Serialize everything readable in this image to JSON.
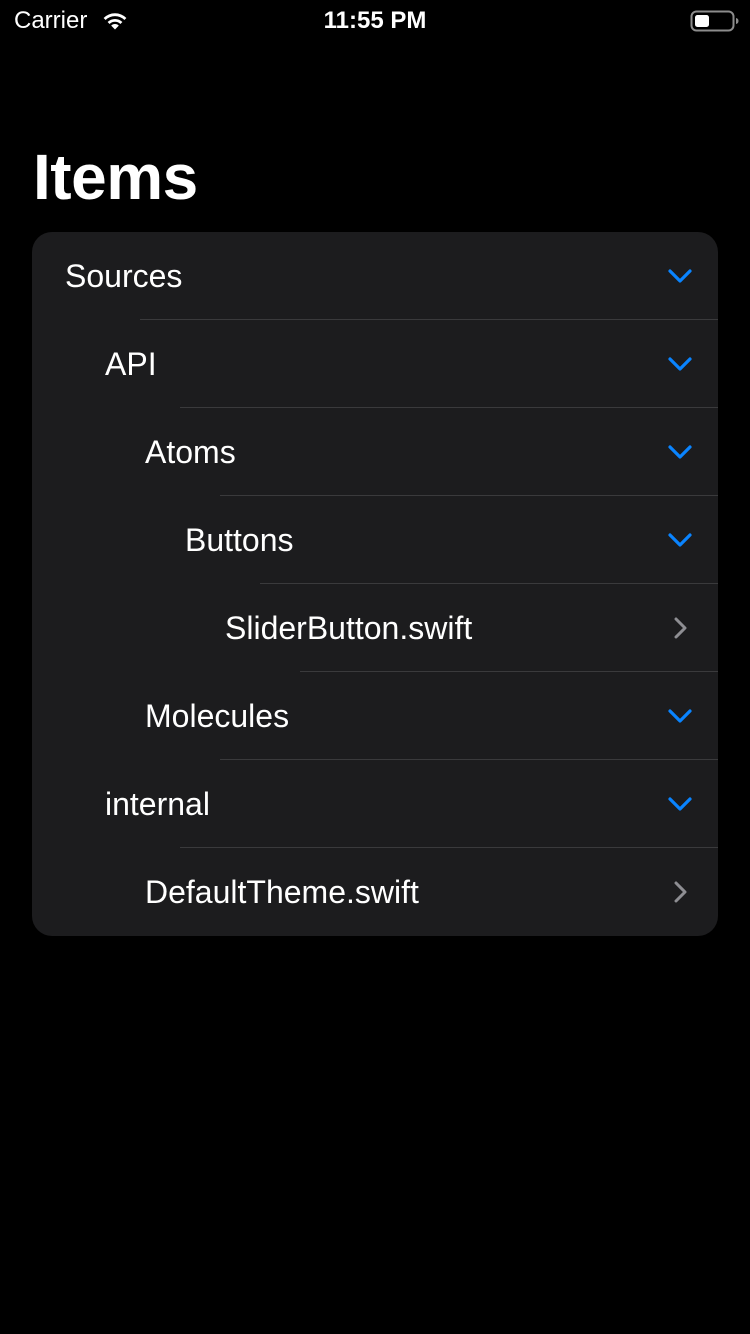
{
  "status_bar": {
    "carrier": "Carrier",
    "time": "11:55 PM",
    "icons": [
      "wifi-icon",
      "battery-icon"
    ]
  },
  "title": "Items",
  "colors": {
    "background": "#000000",
    "card": "#1c1c1e",
    "separator": "#3a3a3c",
    "accent": "#0a84ff",
    "disclosure": "#8e8e93",
    "text": "#ffffff"
  },
  "outline": [
    {
      "label": "Sources",
      "level": 0,
      "kind": "folder",
      "expanded": true,
      "icon": "chevron-down-icon"
    },
    {
      "label": "API",
      "level": 1,
      "kind": "folder",
      "expanded": true,
      "icon": "chevron-down-icon"
    },
    {
      "label": "Atoms",
      "level": 2,
      "kind": "folder",
      "expanded": true,
      "icon": "chevron-down-icon"
    },
    {
      "label": "Buttons",
      "level": 3,
      "kind": "folder",
      "expanded": true,
      "icon": "chevron-down-icon"
    },
    {
      "label": "SliderButton.swift",
      "level": 4,
      "kind": "file",
      "icon": "chevron-right-icon"
    },
    {
      "label": "Molecules",
      "level": 2,
      "kind": "folder",
      "expanded": true,
      "icon": "chevron-down-icon"
    },
    {
      "label": "internal",
      "level": 1,
      "kind": "folder",
      "expanded": true,
      "icon": "chevron-down-icon"
    },
    {
      "label": "DefaultTheme.swift",
      "level": 2,
      "kind": "file",
      "icon": "chevron-right-icon"
    }
  ]
}
